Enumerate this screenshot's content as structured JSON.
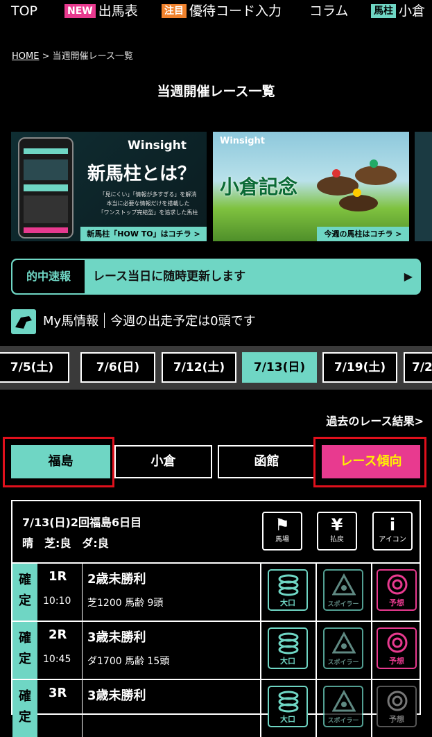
{
  "topnav": {
    "top": "TOP",
    "new_badge": "NEW",
    "entries": "出馬表",
    "attention_badge": "注目",
    "perk_code": "優待コード入力",
    "column": "コラム",
    "umabashira_badge": "馬柱",
    "kokura": "小倉"
  },
  "breadcrumb": {
    "home": "HOME",
    "sep": ">",
    "current": "当週開催レース一覧"
  },
  "page_title": "当週開催レース一覧",
  "banners": {
    "b1": {
      "brand": "Winsight",
      "headline": "新馬柱とは？",
      "body1": "「見にくい」「情報が多すぎる」を解消",
      "body2": "本当に必要な情報だけを搭載した",
      "body3": "「ワンストップ完結型」を追求した馬柱",
      "cta": "新馬柱「HOW TO」はコチラ >"
    },
    "b2": {
      "brand": "Winsight",
      "headline": "小倉記念",
      "cta": "今週の馬柱はコチラ >"
    }
  },
  "hit_news": {
    "label": "的中速報",
    "message": "レース当日に随時更新します",
    "arrow": "▶"
  },
  "my_horse": {
    "label": "My馬情報",
    "message": "今週の出走予定は0頭です"
  },
  "dates": [
    "7/5(土)",
    "7/6(日)",
    "7/12(土)",
    "7/13(日)",
    "7/19(土)",
    "7/2"
  ],
  "selected_date": "7/13(日)",
  "past_results": "過去のレース結果>",
  "venues": [
    "福島",
    "小倉",
    "函館"
  ],
  "trend_tab": "レース傾向",
  "race_header": {
    "line1": "7/13(日)2回福島6日目",
    "line2": "晴　芝:良　ダ:良",
    "buttons": [
      {
        "glyph": "⚑",
        "label": "馬場",
        "icon": "flag-icon"
      },
      {
        "glyph": "¥",
        "label": "払戻",
        "icon": "yen-icon"
      },
      {
        "glyph": "i",
        "label": "アイコン",
        "icon": "info-icon"
      }
    ]
  },
  "races": [
    {
      "status1": "確",
      "status2": "定",
      "no": "1R",
      "time": "10:10",
      "name": "2歳未勝利",
      "meta": "芝1200 馬齢 9頭",
      "btn1": "大口",
      "btn2": "スポイラー",
      "btn3": "予想"
    },
    {
      "status1": "確",
      "status2": "定",
      "no": "2R",
      "time": "10:45",
      "name": "3歳未勝利",
      "meta": "ダ1700 馬齢 15頭",
      "btn1": "大口",
      "btn2": "スポイラー",
      "btn3": "予想"
    },
    {
      "status1": "確",
      "status2": "定",
      "no": "3R",
      "time": "",
      "name": "3歳未勝利",
      "meta": "",
      "btn1": "大口",
      "btn2": "スポイラー",
      "btn3": "予想"
    }
  ],
  "colors": {
    "accent": "#6fd6c4",
    "pink": "#e83a8f",
    "yellow": "#fff200",
    "highlight": "#e0101c"
  }
}
